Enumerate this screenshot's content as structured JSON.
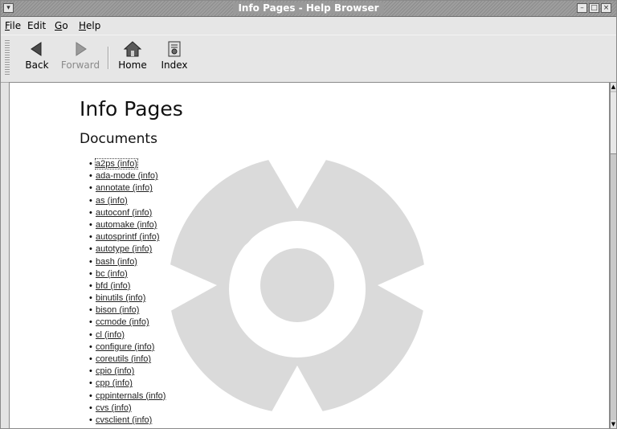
{
  "window": {
    "title": "Info Pages - Help Browser",
    "controls": [
      "minimize",
      "maximize",
      "close"
    ]
  },
  "menubar": {
    "items": [
      {
        "label": "File",
        "mnemonic": "F",
        "rest": "ile"
      },
      {
        "label": "Edit",
        "mnemonic": "",
        "rest": "Edit"
      },
      {
        "label": "Go",
        "mnemonic": "G",
        "rest": "o"
      },
      {
        "label": "Help",
        "mnemonic": "H",
        "rest": "elp"
      }
    ]
  },
  "toolbar": {
    "back_label": "Back",
    "forward_label": "Forward",
    "home_label": "Home",
    "index_label": "Index"
  },
  "page": {
    "title": "Info Pages",
    "section": "Documents",
    "documents": [
      "a2ps (info)",
      "ada-mode (info)",
      "annotate (info)",
      "as (info)",
      "autoconf (info)",
      "automake (info)",
      "autosprintf (info)",
      "autotype (info)",
      "bash (info)",
      "bc (info)",
      "bfd (info)",
      "binutils (info)",
      "bison (info)",
      "ccmode (info)",
      "cl (info)",
      "configure (info)",
      "coreutils (info)",
      "cpio (info)",
      "cpp (info)",
      "cppinternals (info)",
      "cvs (info)",
      "cvsclient (info)"
    ]
  },
  "colors": {
    "watermark": "#d9d9d9",
    "content_bg": "#ffffff",
    "chrome_bg": "#e6e6e6"
  }
}
